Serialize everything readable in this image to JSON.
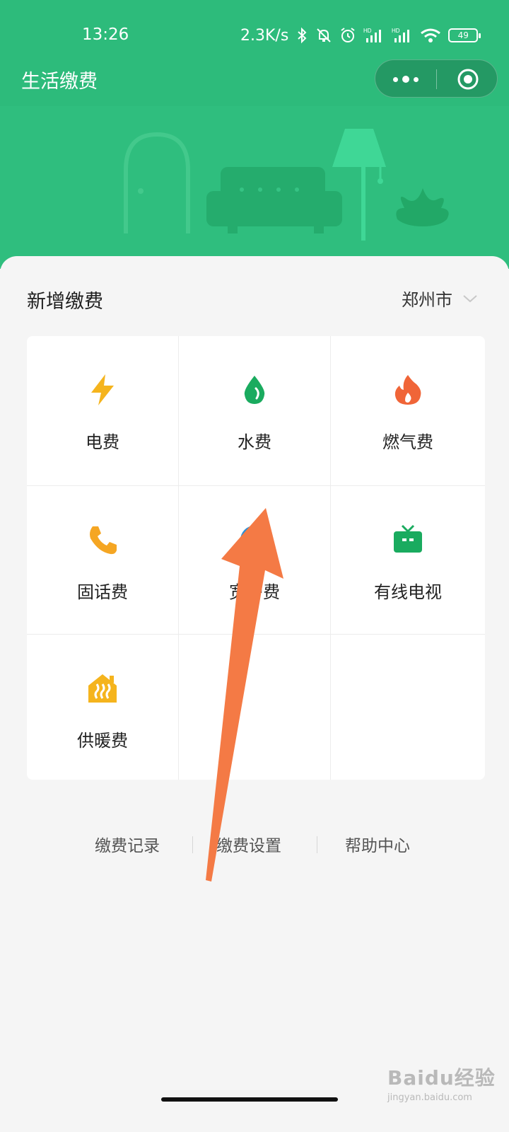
{
  "status_bar": {
    "time": "13:26",
    "net_speed": "2.3K/s",
    "battery": "49",
    "icons": [
      "bluetooth-icon",
      "mute-icon",
      "alarm-icon",
      "signal-hd-icon",
      "signal-hd-icon",
      "wifi-icon",
      "battery-icon"
    ]
  },
  "nav": {
    "title": "生活缴费",
    "capsule_icons": [
      "more-icon",
      "close-target-icon"
    ]
  },
  "section": {
    "title": "新增缴费",
    "city": "郑州市"
  },
  "services": [
    {
      "label": "电费",
      "icon": "lightning-icon",
      "color": "#f5b41d"
    },
    {
      "label": "水费",
      "icon": "water-drop-icon",
      "color": "#1aab5f"
    },
    {
      "label": "燃气费",
      "icon": "flame-icon",
      "color": "#f06538"
    },
    {
      "label": "固话费",
      "icon": "phone-icon",
      "color": "#f5a623"
    },
    {
      "label": "宽带费",
      "icon": "broadband-icon",
      "color": "#2d8fd5"
    },
    {
      "label": "有线电视",
      "icon": "tv-icon",
      "color": "#1aab5f"
    },
    {
      "label": "供暖费",
      "icon": "heating-icon",
      "color": "#f5b41d"
    }
  ],
  "links": [
    "缴费记录",
    "缴费设置",
    "帮助中心"
  ],
  "watermark": {
    "main": "Baidu经验",
    "sub": "jingyan.baidu.com"
  },
  "colors": {
    "header_green": "#2dbb7b",
    "arrow": "#f47a45",
    "background": "#f5f5f5"
  }
}
